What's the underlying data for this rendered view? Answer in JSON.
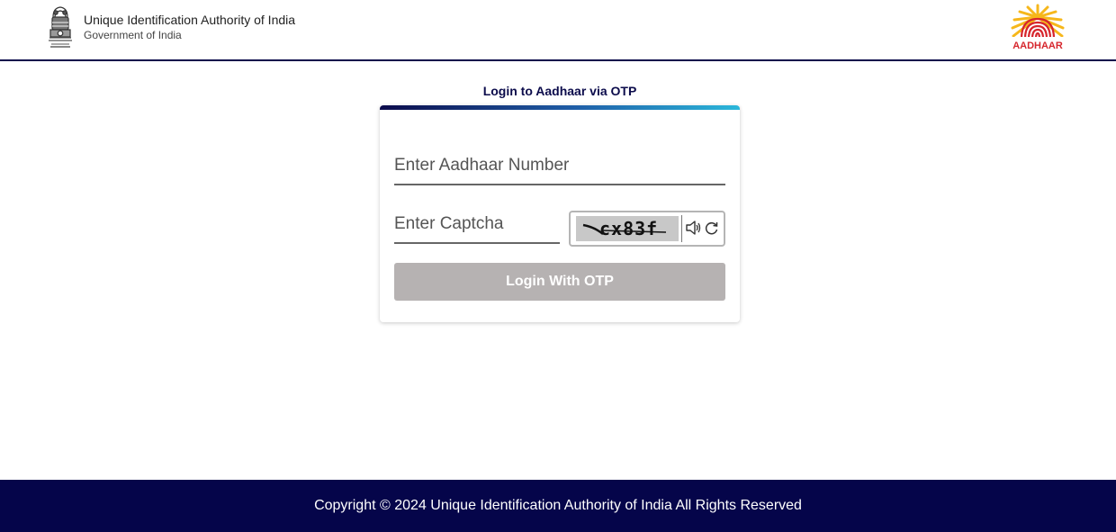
{
  "header": {
    "org_name": "Unique Identification Authority of India",
    "org_sub": "Government of India",
    "emblem_icon": "national-emblem-icon",
    "logo_text": "AADHAAR",
    "logo_icon": "aadhaar-sun-fingerprint-logo"
  },
  "login": {
    "title": "Login to Aadhaar via OTP",
    "aadhaar_placeholder": "Enter Aadhaar Number",
    "aadhaar_value": "",
    "captcha_placeholder": "Enter Captcha",
    "captcha_value": "",
    "captcha_text": "cx83f",
    "speaker_icon": "speaker-icon",
    "refresh_icon": "refresh-icon",
    "submit_label": "Login With OTP"
  },
  "footer": {
    "copyright": "Copyright © 2024 Unique Identification Authority of India All Rights Reserved"
  },
  "colors": {
    "navy": "#0b0b4b",
    "footer_bg": "#05054a",
    "accent_red": "#d6262d",
    "accent_yellow": "#f6b71b",
    "button_disabled": "#b6b2b2"
  }
}
